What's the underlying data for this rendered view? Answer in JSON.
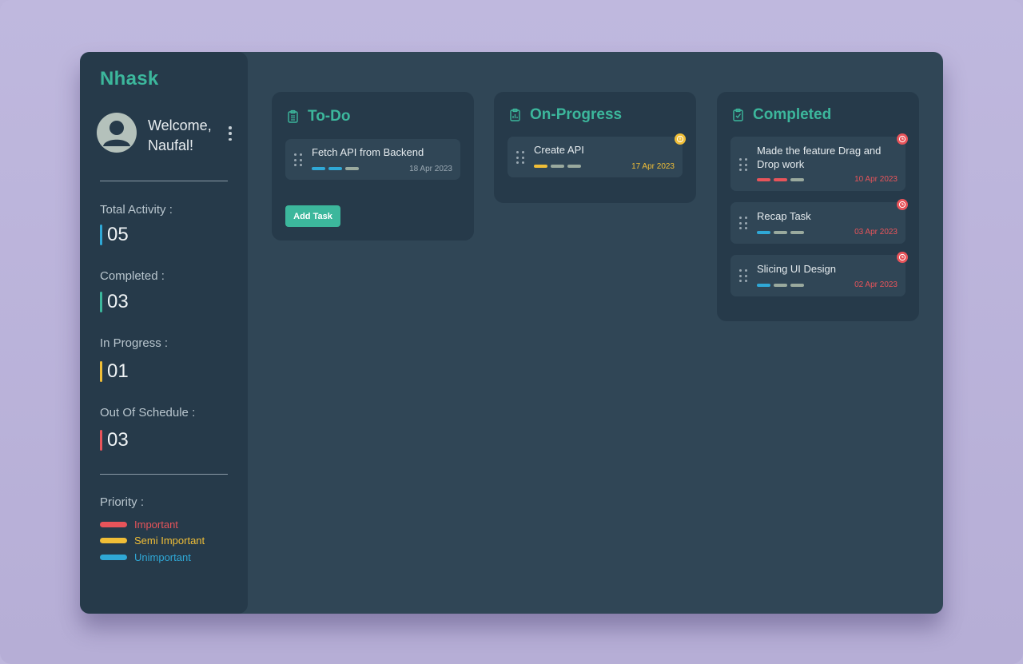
{
  "app": {
    "brand": "Nhask"
  },
  "user": {
    "welcome_line1": "Welcome,",
    "welcome_line2": "Naufal!"
  },
  "stats": {
    "total": {
      "label": "Total Activity :",
      "value": "05",
      "color": "#2fa8d6"
    },
    "completed": {
      "label": "Completed :",
      "value": "03",
      "color": "#3cb79c"
    },
    "in_progress": {
      "label": "In Progress :",
      "value": "01",
      "color": "#f0be37"
    },
    "out_of_schedule": {
      "label": "Out Of Schedule :",
      "value": "03",
      "color": "#e8545a"
    }
  },
  "priority": {
    "title": "Priority :",
    "items": [
      {
        "label": "Important",
        "color": "#e8545a"
      },
      {
        "label": "Semi Important",
        "color": "#f0be37"
      },
      {
        "label": "Unimportant",
        "color": "#2fa8d6"
      }
    ]
  },
  "columns": {
    "todo": {
      "title": "To-Do",
      "icon": "clipboard-list-icon",
      "add_button": "Add Task",
      "cards": [
        {
          "title": "Fetch API from Backend",
          "date": "18 Apr 2023",
          "tags": [
            "#2fa8d6",
            "#2fa8d6",
            "#9aaa9e"
          ],
          "date_color": "#9aa8b2"
        }
      ]
    },
    "progress": {
      "title": "On-Progress",
      "icon": "clipboard-progress-icon",
      "cards": [
        {
          "title": "Create API",
          "date": "17 Apr 2023",
          "tags": [
            "#f0be37",
            "#9aaa9e",
            "#9aaa9e"
          ],
          "date_color": "#f0be37",
          "badge": "warning-icon",
          "badge_color": "#f0be37"
        }
      ]
    },
    "completed": {
      "title": "Completed",
      "icon": "clipboard-check-icon",
      "cards": [
        {
          "title": "Made the feature Drag and Drop work",
          "date": "10 Apr 2023",
          "tags": [
            "#e8545a",
            "#e8545a",
            "#9aaa9e"
          ],
          "date_color": "#e8545a",
          "badge": "clock-icon",
          "badge_color": "#e8545a"
        },
        {
          "title": "Recap Task",
          "date": "03 Apr 2023",
          "tags": [
            "#2fa8d6",
            "#9aaa9e",
            "#9aaa9e"
          ],
          "date_color": "#e8545a",
          "badge": "clock-icon",
          "badge_color": "#e8545a"
        },
        {
          "title": "Slicing UI Design",
          "date": "02 Apr 2023",
          "tags": [
            "#2fa8d6",
            "#9aaa9e",
            "#9aaa9e"
          ],
          "date_color": "#e8545a",
          "badge": "clock-icon",
          "badge_color": "#e8545a"
        }
      ]
    }
  }
}
